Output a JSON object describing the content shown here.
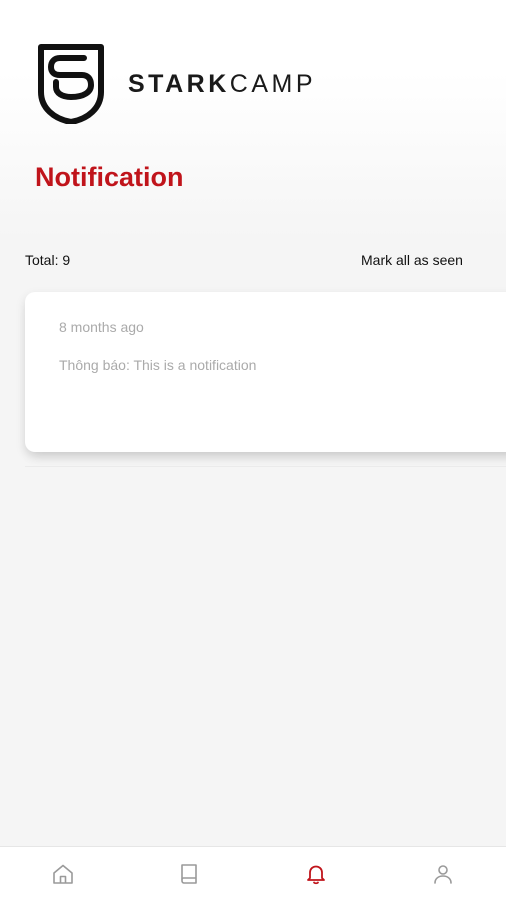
{
  "brand": {
    "name_bold": "STARK",
    "name_light": "CAMP",
    "accent_color": "#c0141b"
  },
  "page": {
    "title": "Notification"
  },
  "summary": {
    "total_label": "Total: 9",
    "mark_all_label": "Mark all as seen"
  },
  "notifications": [
    {
      "time": "8 months ago",
      "message": "Thông báo: This is a notification"
    }
  ],
  "bottom_nav": {
    "items": [
      {
        "icon": "home-icon",
        "active": false
      },
      {
        "icon": "book-icon",
        "active": false
      },
      {
        "icon": "bell-icon",
        "active": true
      },
      {
        "icon": "user-icon",
        "active": false
      }
    ],
    "active_color": "#c0141b",
    "inactive_color": "#9a9a9a"
  }
}
